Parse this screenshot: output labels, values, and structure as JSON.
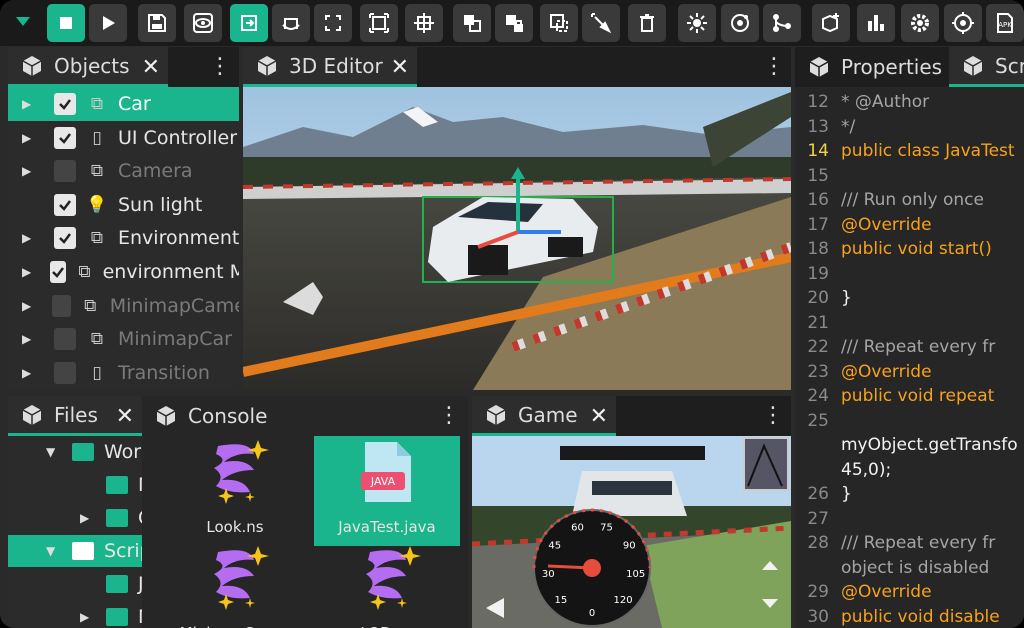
{
  "toolbar": {
    "buttons": [
      "play-stop",
      "play",
      "save",
      "preview",
      "move",
      "rotate",
      "scale",
      "frame",
      "center",
      "merge",
      "lock",
      "duplicate",
      "pick",
      "delete",
      "light",
      "environment",
      "nodes",
      "add-object",
      "charts",
      "settings",
      "target",
      "apk"
    ],
    "apk_label": "APK"
  },
  "objects_panel": {
    "tab_label": "Objects",
    "items": [
      {
        "label": "Car",
        "checked": true,
        "icon": "object-icon",
        "selected": true,
        "expandable": true,
        "dim": false
      },
      {
        "label": "UI Controller",
        "checked": true,
        "icon": "phone-icon",
        "selected": false,
        "expandable": true,
        "dim": false
      },
      {
        "label": "Camera",
        "checked": false,
        "icon": "object-icon",
        "selected": false,
        "expandable": true,
        "dim": true
      },
      {
        "label": "Sun light",
        "checked": true,
        "icon": "bulb-icon",
        "selected": false,
        "expandable": false,
        "dim": false
      },
      {
        "label": "Environment",
        "checked": true,
        "icon": "object-icon",
        "selected": false,
        "expandable": true,
        "dim": false
      },
      {
        "label": "environment M",
        "checked": true,
        "icon": "object-icon",
        "selected": false,
        "expandable": true,
        "dim": false
      },
      {
        "label": "MinimapCame",
        "checked": false,
        "icon": "object-icon",
        "selected": false,
        "expandable": true,
        "dim": true
      },
      {
        "label": "MinimapCar",
        "checked": false,
        "icon": "object-icon",
        "selected": false,
        "expandable": true,
        "dim": true
      },
      {
        "label": "Transition",
        "checked": false,
        "icon": "phone-icon",
        "selected": false,
        "expandable": true,
        "dim": true
      }
    ]
  },
  "editor_panel": {
    "tab_label": "3D Editor"
  },
  "properties_panel": {
    "tabs": [
      "Properties",
      "Scr"
    ],
    "code": [
      {
        "n": "12",
        "text": " * @Author",
        "cls": "c-comment"
      },
      {
        "n": "13",
        "text": "*/",
        "cls": "c-comment"
      },
      {
        "n": "14",
        "text": "public class JavaTest",
        "cls": "c-kw",
        "current": true
      },
      {
        "n": "15",
        "text": "",
        "cls": "c-plain"
      },
      {
        "n": "16",
        "text": "   /// Run only once",
        "cls": "c-comment"
      },
      {
        "n": "17",
        "text": "   @Override",
        "cls": "c-kw"
      },
      {
        "n": "18",
        "text": "   public void start()",
        "cls": "c-kw"
      },
      {
        "n": "19",
        "text": "",
        "cls": "c-plain"
      },
      {
        "n": "20",
        "text": "   }",
        "cls": "c-plain"
      },
      {
        "n": "21",
        "text": "",
        "cls": "c-plain"
      },
      {
        "n": "22",
        "text": "   /// Repeat every fr",
        "cls": "c-comment"
      },
      {
        "n": "23",
        "text": "   @Override",
        "cls": "c-kw"
      },
      {
        "n": "24",
        "text": "   public void repeat",
        "cls": "c-kw"
      },
      {
        "n": "25",
        "text": "",
        "cls": "c-plain"
      },
      {
        "n": "",
        "text": "myObject.getTransfo",
        "cls": "c-plain",
        "wrap": true
      },
      {
        "n": "",
        "text": "45,0);",
        "cls": "c-plain",
        "wrap": true
      },
      {
        "n": "26",
        "text": "   }",
        "cls": "c-plain"
      },
      {
        "n": "27",
        "text": "",
        "cls": "c-plain"
      },
      {
        "n": "28",
        "text": "   /// Repeat every fr",
        "cls": "c-comment"
      },
      {
        "n": "",
        "text": "object is disabled",
        "cls": "c-comment",
        "wrap": true
      },
      {
        "n": "29",
        "text": "   @Override",
        "cls": "c-kw"
      },
      {
        "n": "30",
        "text": "   public void disable",
        "cls": "c-kw"
      }
    ]
  },
  "files_panel": {
    "tab_label": "Files",
    "tree": [
      {
        "label": "Worlc",
        "indent": 0,
        "arrow": "down",
        "selected": false
      },
      {
        "label": "Mi",
        "indent": 1,
        "arrow": "",
        "selected": false
      },
      {
        "label": "Ca",
        "indent": 1,
        "arrow": "right",
        "selected": false
      },
      {
        "label": "Script",
        "indent": 0,
        "arrow": "down",
        "selected": true
      },
      {
        "label": "Ja",
        "indent": 1,
        "arrow": "",
        "selected": false
      },
      {
        "label": "Mi",
        "indent": 1,
        "arrow": "right",
        "selected": false
      }
    ]
  },
  "console_panel": {
    "tab_label": "Console",
    "assets": [
      {
        "name": "Look.ns",
        "type": "ns",
        "selected": false
      },
      {
        "name": "JavaTest.java",
        "type": "java",
        "selected": true
      },
      {
        "name": "MinimapCar.ns",
        "type": "ns",
        "selected": false
      },
      {
        "name": "LOD.ns",
        "type": "ns",
        "selected": false
      }
    ],
    "java_badge": "JAVA"
  },
  "game_panel": {
    "tab_label": "Game",
    "speedometer_ticks": [
      "15",
      "30",
      "45",
      "60",
      "75",
      "90",
      "105",
      "120",
      "0"
    ]
  },
  "colors": {
    "accent": "#1ab58c",
    "toolbar": "#1a1a1a",
    "panel": "#2b2b2b"
  }
}
